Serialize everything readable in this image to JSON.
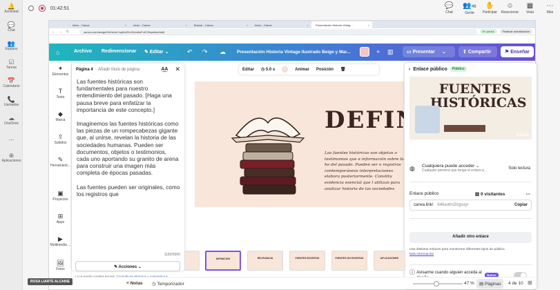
{
  "teams_rail": {
    "items": [
      {
        "label": "Actividad",
        "icon": "bell-icon",
        "glyph": "🔔"
      },
      {
        "label": "Chat",
        "icon": "chat-icon",
        "glyph": "💬"
      },
      {
        "label": "Equipos",
        "icon": "teams-icon",
        "glyph": "👥"
      },
      {
        "label": "Tareas",
        "icon": "tasks-icon",
        "glyph": "☑"
      },
      {
        "label": "Calendario",
        "icon": "calendar-icon",
        "glyph": "📅"
      },
      {
        "label": "Llamadas",
        "icon": "phone-icon",
        "glyph": "📞"
      },
      {
        "label": "OneDrive",
        "icon": "cloud-icon",
        "glyph": "☁"
      },
      {
        "label": "...",
        "icon": "more-icon",
        "glyph": ""
      },
      {
        "label": "Aplicaciones",
        "icon": "apps-icon",
        "glyph": "⊕"
      }
    ]
  },
  "call": {
    "timer": "01:42:51",
    "actions": [
      {
        "label": "Chat",
        "glyph": "💬"
      },
      {
        "label": "Gente",
        "glyph": "👥",
        "count": "46"
      },
      {
        "label": "Participar",
        "glyph": "✋"
      },
      {
        "label": "Reaccionar",
        "glyph": "☺"
      },
      {
        "label": "Vista",
        "glyph": "▦"
      },
      {
        "label": "Más",
        "glyph": "⋯"
      }
    ]
  },
  "browser": {
    "tabs": [
      {
        "label": "Inicio - Canva"
      },
      {
        "label": "Inicio - Canva"
      },
      {
        "label": "Buscar - Canva"
      },
      {
        "label": "Inicio - Canva"
      },
      {
        "label": "Presentación Historia Vintag..."
      }
    ],
    "url": "canva.com/design/DAHz4mYuy8/dZ2v28Uc8IoFnKONqsk6oA/edit",
    "paused": "En pausa",
    "update": "Finalizar actualización"
  },
  "canva_top": {
    "archivo": "Archivo",
    "redimensionar": "Redimensionar",
    "editar": "Editar",
    "title": "Presentación Historia Vintage Ilustrado Beige y Mar...",
    "present": "Presentar",
    "share": "Compartir",
    "teach": "Enseñar"
  },
  "canva_side": [
    {
      "label": "Elementos",
      "glyph": "✶"
    },
    {
      "label": "Texto",
      "glyph": "T"
    },
    {
      "label": "Marca",
      "glyph": "◆"
    },
    {
      "label": "Subidos",
      "glyph": "⇪"
    },
    {
      "label": "Herramient...",
      "glyph": "✎"
    },
    {
      "label": "Proyectos",
      "glyph": "▣"
    },
    {
      "label": "Apps",
      "glyph": "⊞"
    },
    {
      "label": "Multimedia ...",
      "glyph": "▶"
    },
    {
      "label": "Fotos",
      "glyph": "🖼"
    }
  ],
  "notes": {
    "page": "Página 4",
    "add_title": "Añadir título de página",
    "paragraphs": [
      "Las fuentes históricas son fundamentales para nuestro entendimiento del pasado. [Haga una pausa breve para enfatizar la importancia de este concepto.]",
      "Imaginemos las fuentes históricas como las piezas de un rompecabezas gigante que, al unirse, revelan la historia de las sociedades humanas. Pueden ser documentos, objetos o testimonios, cada uno aportando su granito de arena para construir una imagen más completa de épocas pasadas.",
      "Las fuentes pueden ser originales, como los registros que"
    ],
    "counter": "1182/5000",
    "actions": "Acciones",
    "disclaimer_prefix": "La IA puede cometer errores.",
    "terms": "Consulta los términos",
    "disclaimer_mid": "o",
    "share_feedback": "comparte tus comentarios."
  },
  "toolbar": {
    "edit": "Editar",
    "duration": "5.0 s",
    "animate": "Animar",
    "position": "Posición"
  },
  "slide": {
    "title": "DEFINIC",
    "body": "Las fuentes históricas son objetos o testimonios que e información sobre los he del pasado. Pueden ser o registros contemporáneos interpretaciones elabora posteriormente. Constitu evidencia esencial que l utilizan para analizar historia de las sociedades"
  },
  "share_panel": {
    "header": "Enlace público",
    "badge": "Público",
    "preview_title": "FUENTES HISTÓRICAS",
    "preview_logo": "Canva",
    "access_title": "Cualquiera puede acceder",
    "access_sub": "Cualquier persona que tenga el enlace p...",
    "access_role": "Solo lectura",
    "link_label": "Enlace público",
    "visitors": "0 visitantes",
    "link_prefix": "canva.link/",
    "link_slug": "646aohn2trgsuyr",
    "copy": "Copiar",
    "add_link": "Añadir otro enlace",
    "hint": "Usa distintos enlaces para monitorear diferentes tipos de público.",
    "more_info": "Más información",
    "notify": "Avisarme cuando alguien acceda al diseño",
    "new_badge": "Nuevo"
  },
  "thumbnails": [
    {
      "label": ""
    },
    {
      "label": "DEFINICIÓN"
    },
    {
      "label": "RELEVANCIA"
    },
    {
      "label": "FUENTES ESCRITAS"
    },
    {
      "label": "FUENTES NO ESCRITAS"
    },
    {
      "label": "APLICACIONES"
    }
  ],
  "bottom": {
    "pill": "ROSA LIARTE ALCAINE",
    "notes": "Notas",
    "timer": "Temporizador",
    "zoom": "47 %",
    "zoom_fraction": 0.47,
    "pages": "Páginas",
    "page_count": "4 de 10"
  },
  "colors": {
    "accent": "#7b4ff0",
    "slide_bg": "#f9e6da",
    "public_badge": "#d9f4dd"
  }
}
